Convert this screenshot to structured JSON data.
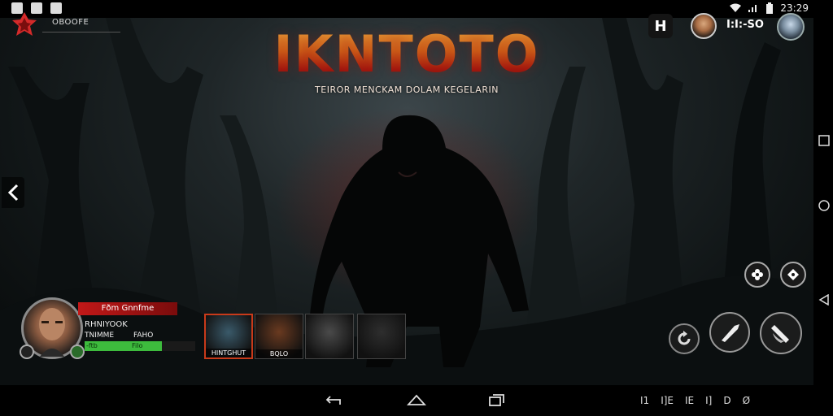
{
  "status_bar": {
    "time": "23:29",
    "left_icons": [
      "image-icon",
      "gear-icon",
      "message-icon"
    ],
    "right_icons": [
      "wifi-icon",
      "signal-icon",
      "battery-icon"
    ]
  },
  "header": {
    "player_id": "OBOOFE",
    "title": "IKNTOTO",
    "subtitle": "TEIROR MENCKAM DOLAM KEGELARIN",
    "h_button": "H",
    "score": "I:I:-SO"
  },
  "player": {
    "banner": "Fðm Gnnfme",
    "name": "RHNIYOOK",
    "stat_left": "TNIMME",
    "stat_right": "FAHO",
    "bar_label_left": "-ftb",
    "bar_label_right": "Filo",
    "health_fraction": 0.7
  },
  "character_cards": [
    {
      "caption": "HINTGHUT",
      "tone": "#3a5a6a"
    },
    {
      "caption": "BQLO",
      "tone": "#6a3a20"
    },
    {
      "caption": "",
      "tone": "#4a4a4a"
    },
    {
      "caption": "",
      "tone": "#2e2e2e"
    }
  ],
  "colors": {
    "title_top": "#f0b040",
    "title_bottom": "#a41a10",
    "banner_red": "#c21818",
    "health_green": "#3dbb3d"
  },
  "nav_bottom": {
    "icons": [
      "back-icon",
      "home-icon",
      "recents-icon"
    ],
    "right_labels": [
      "I1",
      "I]E",
      "IE",
      "I]",
      "D",
      "Ø"
    ]
  }
}
